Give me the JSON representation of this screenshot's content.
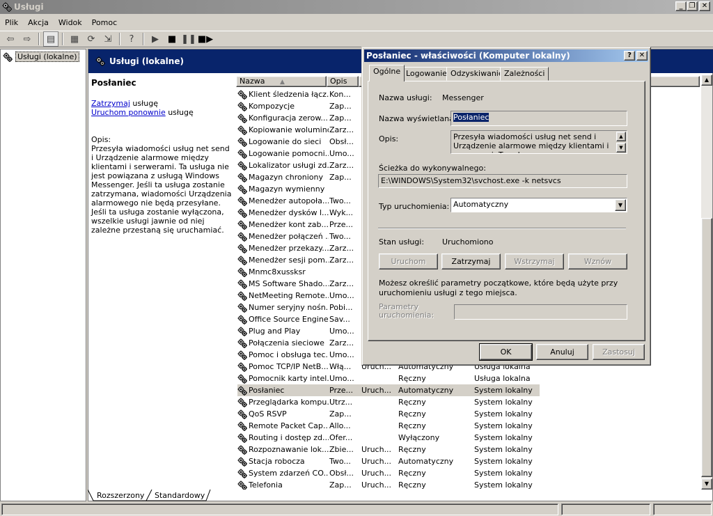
{
  "window": {
    "title": "Usługi"
  },
  "menu": [
    "Plik",
    "Akcja",
    "Widok",
    "Pomoc"
  ],
  "tree": {
    "root": "Usługi (lokalne)"
  },
  "pane": {
    "header": "Usługi (lokalne)",
    "service_title": "Posłaniec",
    "stop_link": "Zatrzymaj",
    "stop_suffix": " usługę",
    "restart_link": "Uruchom ponownie",
    "restart_suffix": " usługę",
    "desc_label": "Opis:",
    "desc_text": "Przesyła wiadomości usług net send i Urządzenie alarmowe między klientami i serwerami. Ta usługa nie jest powiązana z usługą Windows Messenger. Jeśli ta usługa zostanie zatrzymana, wiadomości Urządzenia alarmowego nie będą przesyłane. Jeśli ta usługa zostanie wyłączona, wszelkie usługi jawnie od niej zależne przestaną się uruchamiać."
  },
  "columns": {
    "name": "Nazwa",
    "desc": "Opis"
  },
  "services": [
    {
      "name": "Klient śledzenia łącz...",
      "desc": "Kon...",
      "status": "",
      "startup": "",
      "logon": ""
    },
    {
      "name": "Kompozycje",
      "desc": "Zap...",
      "status": "",
      "startup": "",
      "logon": ""
    },
    {
      "name": "Konfiguracja zerow...",
      "desc": "Zap...",
      "status": "",
      "startup": "",
      "logon": ""
    },
    {
      "name": "Kopiowanie woluminów...",
      "desc": "Zarz...",
      "status": "",
      "startup": "",
      "logon": ""
    },
    {
      "name": "Logowanie do sieci",
      "desc": "Obsł...",
      "status": "",
      "startup": "",
      "logon": ""
    },
    {
      "name": "Logowanie pomocni...",
      "desc": "Umo...",
      "status": "",
      "startup": "",
      "logon": ""
    },
    {
      "name": "Lokalizator usługi zd...",
      "desc": "Zarz...",
      "status": "",
      "startup": "",
      "logon": ""
    },
    {
      "name": "Magazyn chroniony",
      "desc": "Zap...",
      "status": "",
      "startup": "",
      "logon": ""
    },
    {
      "name": "Magazyn wymienny",
      "desc": "",
      "status": "",
      "startup": "",
      "logon": ""
    },
    {
      "name": "Menedżer autopoła...",
      "desc": "Two...",
      "status": "",
      "startup": "",
      "logon": ""
    },
    {
      "name": "Menedżer dysków l...",
      "desc": "Wyk...",
      "status": "",
      "startup": "",
      "logon": ""
    },
    {
      "name": "Menedżer kont zab...",
      "desc": "Prze...",
      "status": "",
      "startup": "",
      "logon": ""
    },
    {
      "name": "Menedżer połączeń ...",
      "desc": "Two...",
      "status": "",
      "startup": "",
      "logon": ""
    },
    {
      "name": "Menedżer przekazy...",
      "desc": "Zarz...",
      "status": "",
      "startup": "",
      "logon": ""
    },
    {
      "name": "Menedżer sesji pom...",
      "desc": "Zarz...",
      "status": "",
      "startup": "",
      "logon": ""
    },
    {
      "name": "Mnmc8xussksr",
      "desc": "",
      "status": "",
      "startup": "",
      "logon": ""
    },
    {
      "name": "MS Software Shado...",
      "desc": "Zarz...",
      "status": "",
      "startup": "",
      "logon": ""
    },
    {
      "name": "NetMeeting Remote...",
      "desc": "Umo...",
      "status": "",
      "startup": "",
      "logon": ""
    },
    {
      "name": "Numer seryjny nośn...",
      "desc": "Pobi...",
      "status": "",
      "startup": "",
      "logon": ""
    },
    {
      "name": "Office Source Engine",
      "desc": "Sav...",
      "status": "",
      "startup": "",
      "logon": ""
    },
    {
      "name": "Plug and Play",
      "desc": "Umo...",
      "status": "",
      "startup": "",
      "logon": ""
    },
    {
      "name": "Połączenia sieciowe",
      "desc": "Zarz...",
      "status": "",
      "startup": "",
      "logon": ""
    },
    {
      "name": "Pomoc i obsługa tec...",
      "desc": "Umo...",
      "status": "",
      "startup": "",
      "logon": ""
    },
    {
      "name": "Pomoc TCP/IP NetB...",
      "desc": "Włą...",
      "status": "Uruch...",
      "startup": "Automatyczny",
      "logon": "Usługa lokalna"
    },
    {
      "name": "Pomocnik karty intel...",
      "desc": "Umo...",
      "status": "",
      "startup": "Ręczny",
      "logon": "Usługa lokalna"
    },
    {
      "name": "Posłaniec",
      "desc": "Prze...",
      "status": "Uruch...",
      "startup": "Automatyczny",
      "logon": "System lokalny"
    },
    {
      "name": "Przeglądarka kompu...",
      "desc": "Utrz...",
      "status": "",
      "startup": "Ręczny",
      "logon": "System lokalny"
    },
    {
      "name": "QoS RSVP",
      "desc": "Zap...",
      "status": "",
      "startup": "Ręczny",
      "logon": "System lokalny"
    },
    {
      "name": "Remote Packet Cap...",
      "desc": "Allo...",
      "status": "",
      "startup": "Ręczny",
      "logon": "System lokalny"
    },
    {
      "name": "Routing i dostęp zd...",
      "desc": "Ofer...",
      "status": "",
      "startup": "Wyłączony",
      "logon": "System lokalny"
    },
    {
      "name": "Rozpoznawanie lok...",
      "desc": "Zbie...",
      "status": "Uruch...",
      "startup": "Ręczny",
      "logon": "System lokalny"
    },
    {
      "name": "Stacja robocza",
      "desc": "Two...",
      "status": "Uruch...",
      "startup": "Automatyczny",
      "logon": "System lokalny"
    },
    {
      "name": "System zdarzeń CO...",
      "desc": "Obsł...",
      "status": "Uruch...",
      "startup": "Ręczny",
      "logon": "System lokalny"
    },
    {
      "name": "Telefonia",
      "desc": "Zap...",
      "status": "Uruch...",
      "startup": "Ręczny",
      "logon": "System lokalny"
    }
  ],
  "bottom_tabs": [
    "Rozszerzony",
    "Standardowy"
  ],
  "dialog": {
    "title": "Posłaniec - właściwości (Komputer lokalny)",
    "help_btn": "?",
    "close_btn": "✕",
    "tabs": [
      "Ogólne",
      "Logowanie",
      "Odzyskiwanie",
      "Zależności"
    ],
    "service_name_label": "Nazwa usługi:",
    "service_name": "Messenger",
    "display_name_label": "Nazwa wyświetlana:",
    "display_name": "Posłaniec",
    "desc_label": "Opis:",
    "desc": "Przesyła wiadomości usług net send i Urządzenie alarmowe między klientami i serwerami. Ta usługa",
    "path_label": "Ścieżka do wykonywalnego:",
    "path": "E:\\WINDOWS\\System32\\svchost.exe -k netsvcs",
    "startup_label": "Typ uruchomienia:",
    "startup": "Automatyczny",
    "status_label": "Stan usługi:",
    "status": "Uruchomiono",
    "start_btn": "Uruchom",
    "stop_btn": "Zatrzymaj",
    "pause_btn": "Wstrzymaj",
    "resume_btn": "Wznów",
    "hint": "Możesz określić parametry początkowe, które będą użyte przy uruchomieniu usługi z tego miejsca.",
    "params_label": "Parametry uruchomienia:",
    "params": "",
    "ok": "OK",
    "cancel": "Anuluj",
    "apply": "Zastosuj"
  }
}
